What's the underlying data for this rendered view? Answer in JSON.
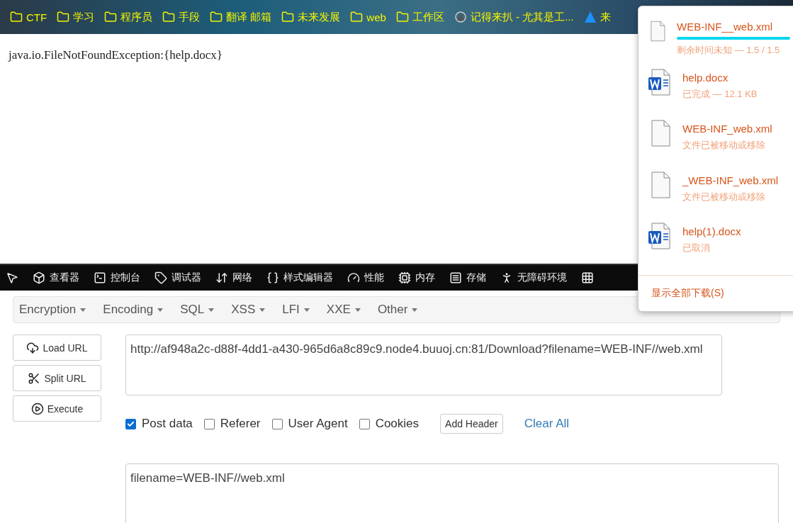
{
  "bookmarks": [
    {
      "label": "CTF",
      "kind": "folder"
    },
    {
      "label": "学习",
      "kind": "folder"
    },
    {
      "label": "程序员",
      "kind": "folder"
    },
    {
      "label": "手段",
      "kind": "folder"
    },
    {
      "label": "翻译 邮箱",
      "kind": "folder"
    },
    {
      "label": "未来发展",
      "kind": "folder"
    },
    {
      "label": "web",
      "kind": "folder"
    },
    {
      "label": "工作区",
      "kind": "folder"
    },
    {
      "label": "记得来扒 - 尤其是工...",
      "kind": "site"
    },
    {
      "label": "来",
      "kind": "logo"
    }
  ],
  "page": {
    "error": "java.io.FileNotFoundException:{help.docx}"
  },
  "devtools": {
    "tabs": [
      {
        "label": "查看器"
      },
      {
        "label": "控制台"
      },
      {
        "label": "调试器"
      },
      {
        "label": "网络"
      },
      {
        "label": "样式编辑器"
      },
      {
        "label": "性能"
      },
      {
        "label": "内存"
      },
      {
        "label": "存储"
      },
      {
        "label": "无障碍环境"
      }
    ]
  },
  "hackbar": {
    "menus": [
      "Encryption",
      "Encoding",
      "SQL",
      "XSS",
      "LFI",
      "XXE",
      "Other"
    ],
    "actions": [
      "Load URL",
      "Split URL",
      "Execute"
    ],
    "url": "http://af948a2c-d88f-4dd1-a430-965d6a8c89c9.node4.buuoj.cn:81/Download?filename=WEB-INF//web.xml",
    "options": [
      {
        "label": "Post data",
        "checked": true
      },
      {
        "label": "Referer",
        "checked": false
      },
      {
        "label": "User Agent",
        "checked": false
      },
      {
        "label": "Cookies",
        "checked": false
      }
    ],
    "add_header": "Add Header",
    "clear_all": "Clear All",
    "post_body": "filename=WEB-INF//web.xml"
  },
  "downloads": {
    "items": [
      {
        "name": "WEB-INF__web.xml",
        "status": "剩余时间未知 — 1.5 / 1.5",
        "kind": "file",
        "level": 1
      },
      {
        "name": "help.docx",
        "status": "已完成 — 12.1 KB",
        "kind": "word"
      },
      {
        "name": "WEB-INF_web.xml",
        "status": "文件已被移动或移除",
        "kind": "file"
      },
      {
        "name": "_WEB-INF_web.xml",
        "status": "文件已被移动或移除",
        "kind": "file"
      },
      {
        "name": "help(1).docx",
        "status": "已取消",
        "kind": "word"
      }
    ],
    "show_all": "显示全部下载(S)"
  }
}
